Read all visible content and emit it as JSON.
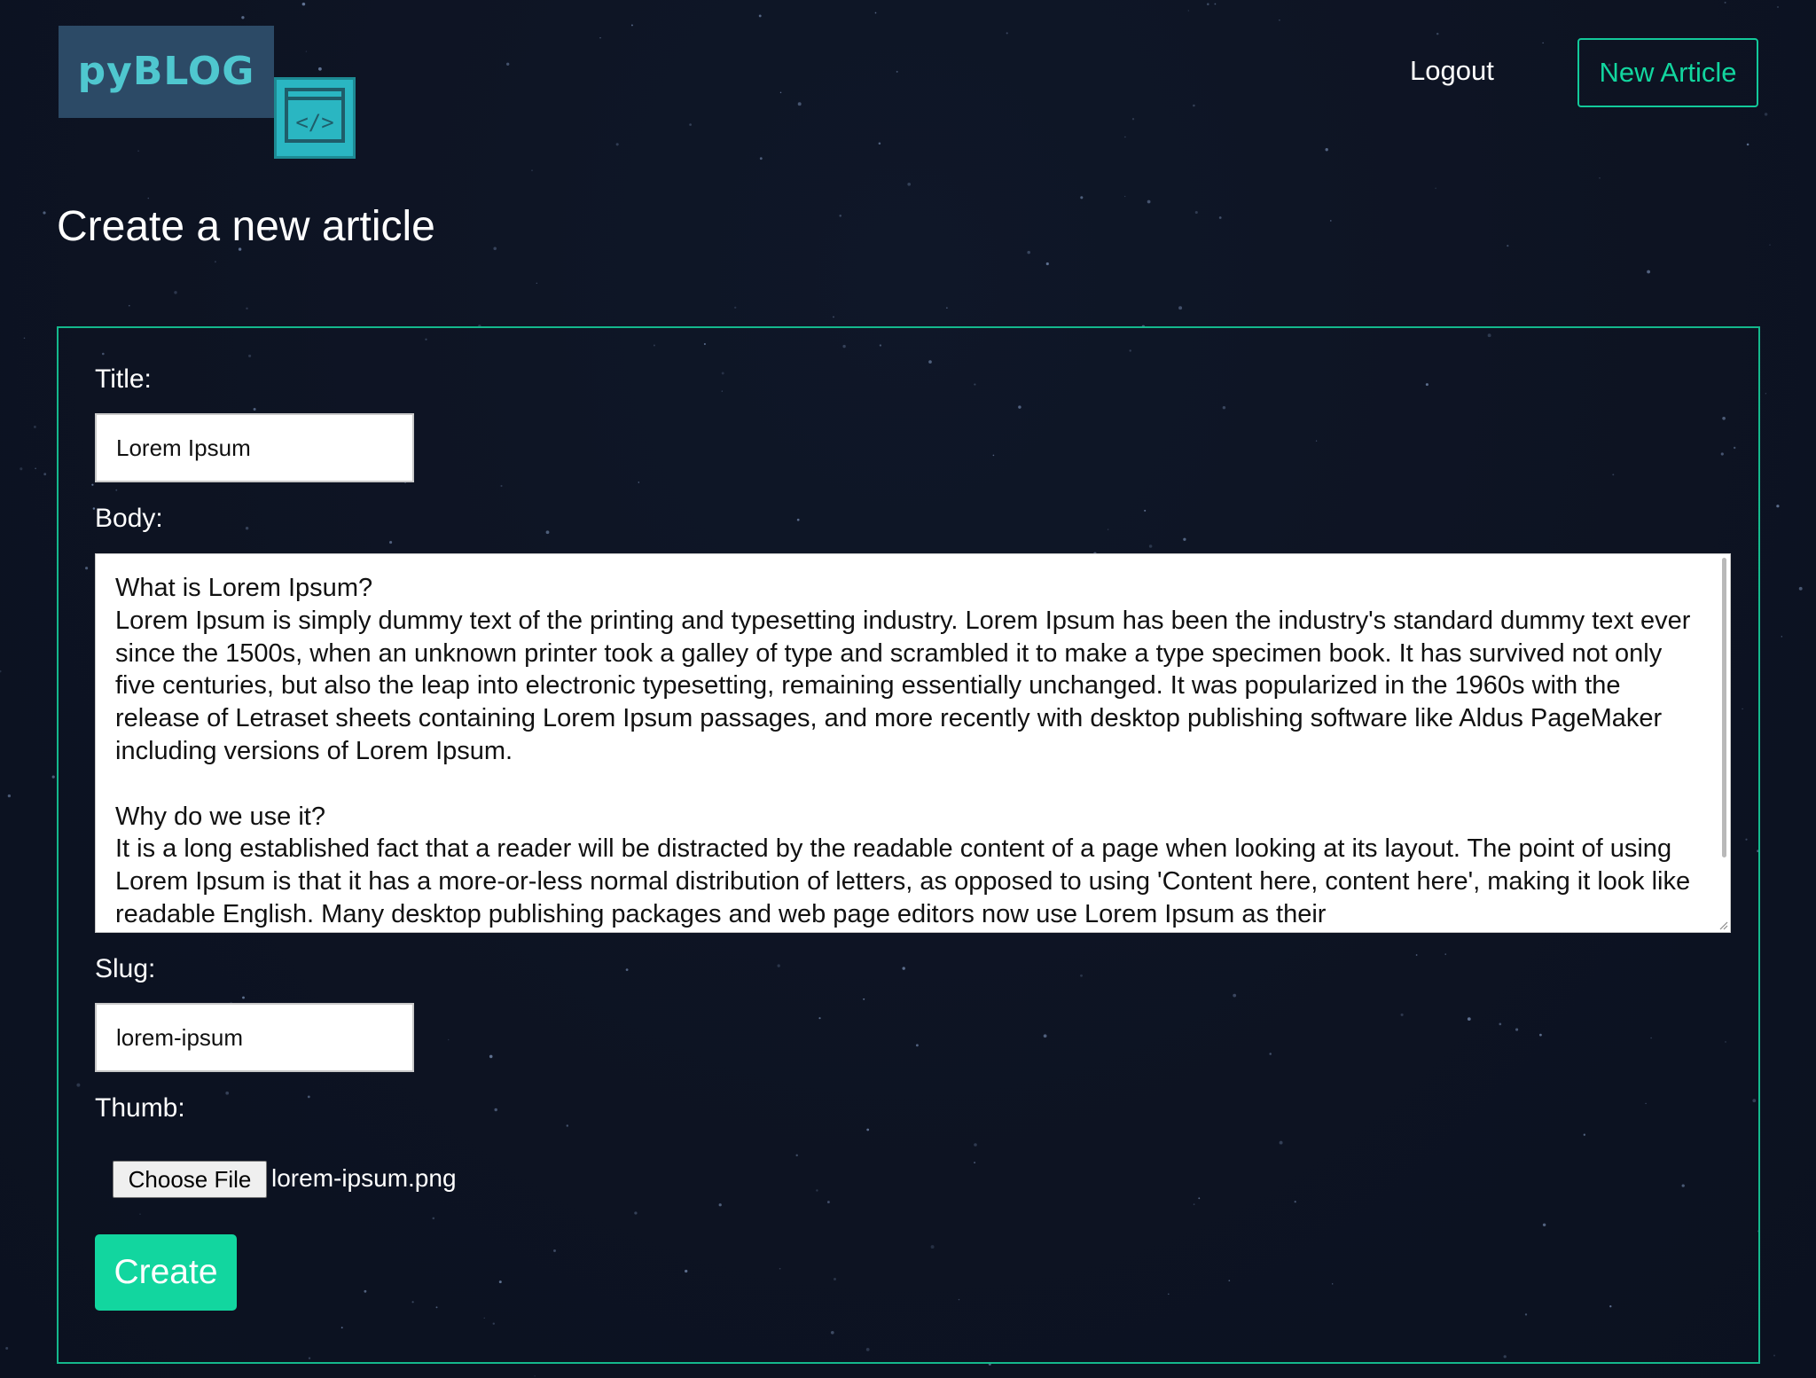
{
  "logo": {
    "text": "pyBLOG",
    "badge_glyph": "</>",
    "icon": "code-icon"
  },
  "nav": {
    "logout_label": "Logout",
    "new_article_label": "New Article"
  },
  "page_title": "Create a new article",
  "form": {
    "title_label": "Title:",
    "title_value": "Lorem Ipsum",
    "body_label": "Body:",
    "body_value": "What is Lorem Ipsum?\nLorem Ipsum is simply dummy text of the printing and typesetting industry. Lorem Ipsum has been the industry's standard dummy text ever since the 1500s, when an unknown printer took a galley of type and scrambled it to make a type specimen book. It has survived not only five centuries, but also the leap into electronic typesetting, remaining essentially unchanged. It was popularized in the 1960s with the release of Letraset sheets containing Lorem Ipsum passages, and more recently with desktop publishing software like Aldus PageMaker including versions of Lorem Ipsum.\n\nWhy do we use it?\nIt is a long established fact that a reader will be distracted by the readable content of a page when looking at its layout. The point of using Lorem Ipsum is that it has a more-or-less normal distribution of letters, as opposed to using 'Content here, content here', making it look like readable English. Many desktop publishing packages and web page editors now use Lorem Ipsum as their",
    "slug_label": "Slug:",
    "slug_value": "lorem-ipsum",
    "thumb_label": "Thumb:",
    "choose_file_label": "Choose File",
    "file_name": "lorem-ipsum.png",
    "create_label": "Create"
  },
  "colors": {
    "background": "#0d1322",
    "accent": "#12d69f",
    "logo_bg": "#2c4a66",
    "logo_badge": "#2ab6c2"
  }
}
